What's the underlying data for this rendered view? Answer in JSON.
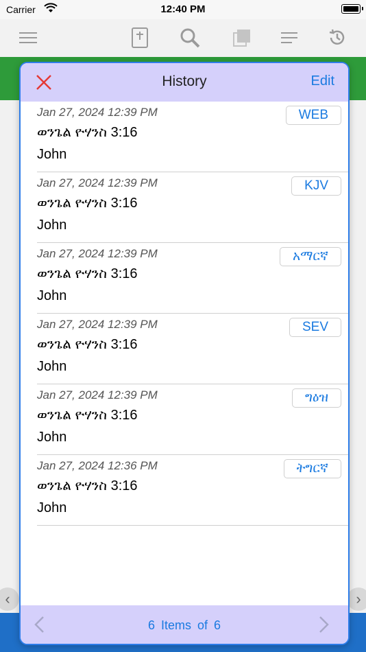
{
  "status_bar": {
    "carrier": "Carrier",
    "time": "12:40 PM"
  },
  "toolbar": {
    "icons": [
      "menu-icon",
      "bible-icon",
      "search-icon",
      "copy-icon",
      "list-icon",
      "history-icon"
    ]
  },
  "modal": {
    "title": "History",
    "edit_label": "Edit",
    "close_icon": "close-icon",
    "items": [
      {
        "date": "Jan 27, 2024 12:39 PM",
        "reference": "ወንጌል ዮሃንስ 3:16",
        "book": "John",
        "version": "WEB"
      },
      {
        "date": "Jan 27, 2024 12:39 PM",
        "reference": "ወንጌል ዮሃንስ 3:16",
        "book": "John",
        "version": "KJV"
      },
      {
        "date": "Jan 27, 2024 12:39 PM",
        "reference": "ወንጌል ዮሃንስ 3:16",
        "book": "John",
        "version": "አማርኛ"
      },
      {
        "date": "Jan 27, 2024 12:39 PM",
        "reference": "ወንጌል ዮሃንስ 3:16",
        "book": "John",
        "version": "SEV"
      },
      {
        "date": "Jan 27, 2024 12:39 PM",
        "reference": "ወንጌል ዮሃንስ 3:16",
        "book": "John",
        "version": "ግዕዝ"
      },
      {
        "date": "Jan 27, 2024 12:36 PM",
        "reference": "ወንጌል ዮሃንስ 3:16",
        "book": "John",
        "version": "ትግርኛ"
      }
    ],
    "footer": {
      "count_text": "6 Items of 6"
    }
  },
  "colors": {
    "accent": "#1a7ae0",
    "header_bg": "#d5d0fb",
    "close": "#e53935",
    "green_band": "#2e9b3a",
    "blue_band": "#1f6fc7"
  }
}
